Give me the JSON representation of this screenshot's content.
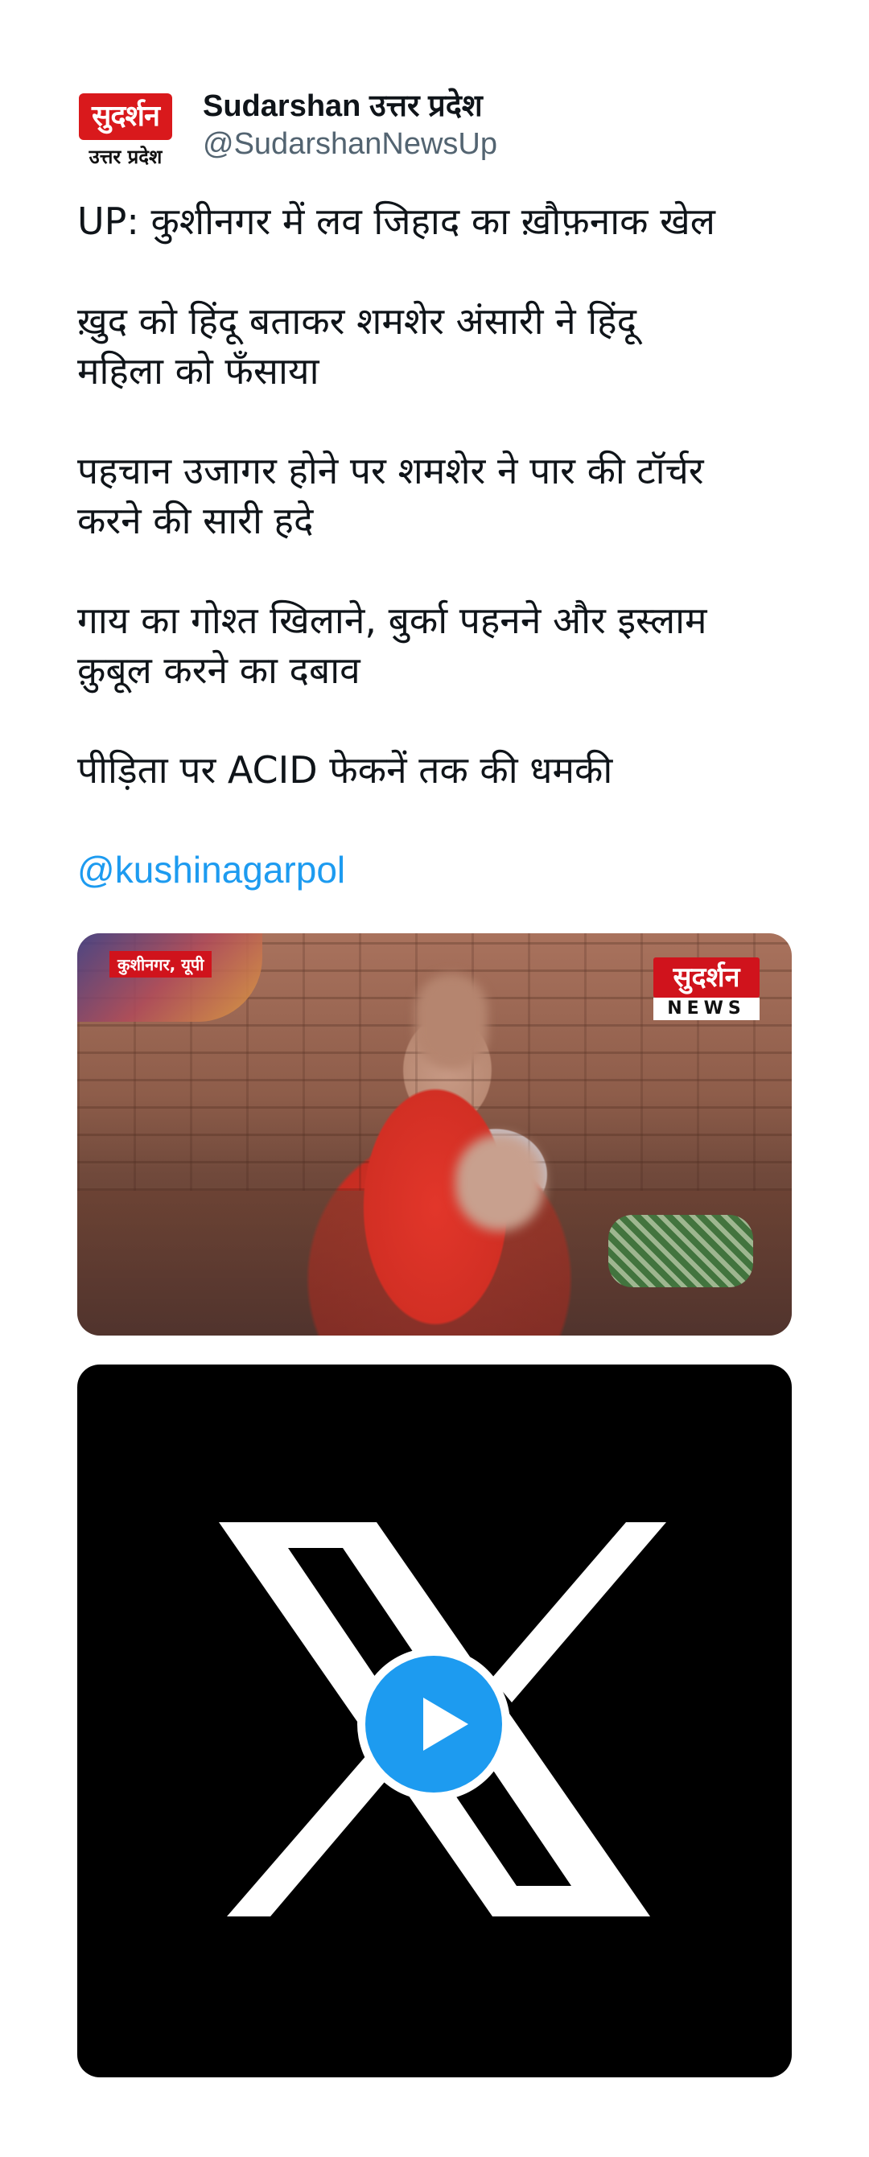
{
  "account": {
    "avatar_brand": "सुदर्शन",
    "avatar_sub": "उत्तर प्रदेश",
    "name": "Sudarshan उत्तर प्रदेश",
    "handle": "@SudarshanNewsUp"
  },
  "tweet": {
    "paragraphs": [
      "UP: कुशीनगर में लव जिहाद का ख़ौफ़नाक खेल",
      "ख़ुद को हिंदू बताकर शमशेर अंसारी ने हिंदू\nमहिला को फँसाया",
      "पहचान उजागर होने पर शमशेर ने पार की टॉर्चर\nकरने की सारी हदे",
      "गाय का गोश्त खिलाने, बुर्का पहनने और इस्लाम\nक़ुबूल करने का दबाव",
      "पीड़िता पर ACID फेकनें तक की धमकी"
    ],
    "mention": "@kushinagarpol"
  },
  "media_image": {
    "location_tag": "कुशीनगर, यूपी",
    "logo_top": "सुदर्शन",
    "logo_bottom": "NEWS"
  },
  "media_video": {
    "icon": "x-logo-icon",
    "play_icon": "play-icon",
    "accent": "#1d9bf0",
    "background": "#000000"
  },
  "colors": {
    "text": "#0f1419",
    "secondary": "#536471",
    "link": "#1d9bf0",
    "brand_red": "#d9191c"
  }
}
